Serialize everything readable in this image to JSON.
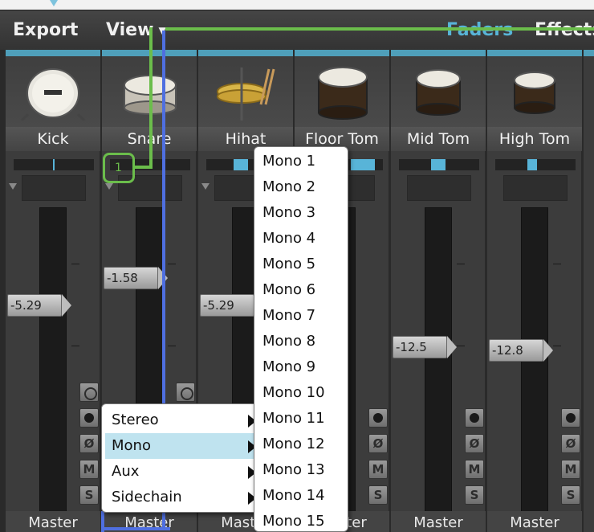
{
  "menu": {
    "export_label": "Export",
    "view_label": "View",
    "faders_label": "Faders",
    "effects_label": "Effects"
  },
  "colors": {
    "accent": "#58b4d8",
    "routing_green": "#6bbd4b",
    "routing_blue": "#4f6fe0"
  },
  "channels": [
    {
      "name": "Kick",
      "fader_label": "-5.29",
      "output": "Master",
      "icon": "kick-drum-icon"
    },
    {
      "name": "Snare",
      "fader_label": "-1.58",
      "output": "Master",
      "icon": "snare-drum-icon"
    },
    {
      "name": "Hihat",
      "fader_label": "-5.29",
      "output": "Master",
      "icon": "hihat-icon"
    },
    {
      "name": "Floor Tom",
      "fader_label": "",
      "output": "Master",
      "icon": "floor-tom-icon"
    },
    {
      "name": "Mid Tom",
      "fader_label": "-12.5",
      "output": "Master",
      "icon": "mid-tom-icon"
    },
    {
      "name": "High Tom",
      "fader_label": "-12.8",
      "output": "Master",
      "icon": "high-tom-icon"
    }
  ],
  "routing_badge": "1",
  "buttons": {
    "phase": "Ø",
    "mute": "M",
    "solo": "S"
  },
  "context_menu": {
    "items": [
      {
        "label": "Stereo"
      },
      {
        "label": "Mono"
      },
      {
        "label": "Aux"
      },
      {
        "label": "Sidechain"
      }
    ],
    "selected": "Mono"
  },
  "mono_submenu": [
    "Mono 1",
    "Mono 2",
    "Mono 3",
    "Mono 4",
    "Mono 5",
    "Mono 6",
    "Mono 7",
    "Mono 8",
    "Mono 9",
    "Mono 10",
    "Mono 11",
    "Mono 12",
    "Mono 13",
    "Mono 14",
    "Mono 15"
  ]
}
